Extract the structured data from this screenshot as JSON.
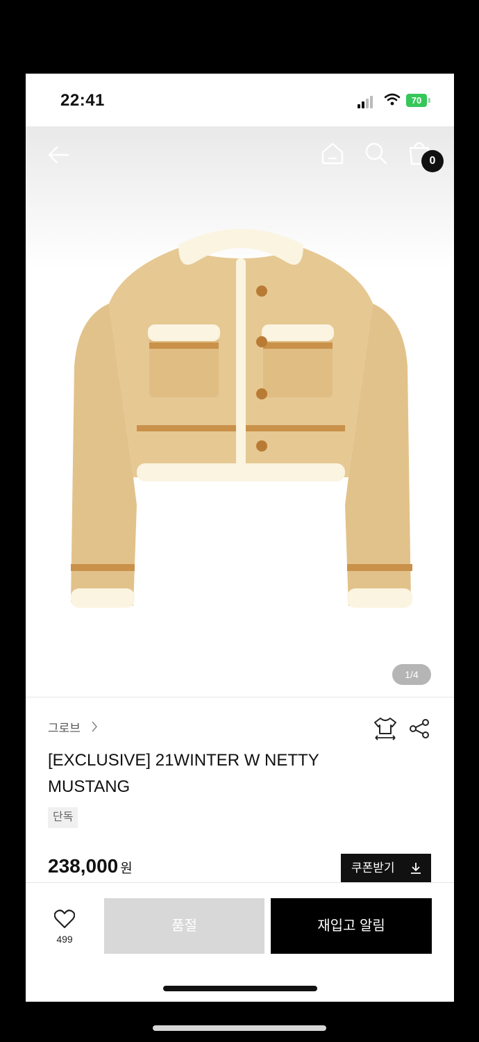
{
  "status_bar": {
    "time": "22:41",
    "battery": "70"
  },
  "header": {
    "cart_count": "0"
  },
  "gallery": {
    "counter": "1/4"
  },
  "product": {
    "brand": "그로브",
    "title": "[EXCLUSIVE] 21WINTER W NETTY MUSTANG",
    "tag": "단독",
    "price": "238,000",
    "currency": "원",
    "coupon_label": "쿠폰받기"
  },
  "bottom_bar": {
    "wish_count": "499",
    "soldout_label": "품절",
    "restock_label": "재입고 알림"
  },
  "colors": {
    "accent": "#000000",
    "soldout": "#d8d8d8",
    "jacket": "#e6c893",
    "trim": "#c9914a",
    "fleece": "#faf4e1"
  },
  "icons": [
    "back-arrow-icon",
    "home-icon",
    "search-icon",
    "shopping-bag-icon",
    "chevron-right-icon",
    "size-guide-tshirt-icon",
    "share-icon",
    "download-icon",
    "heart-icon"
  ]
}
